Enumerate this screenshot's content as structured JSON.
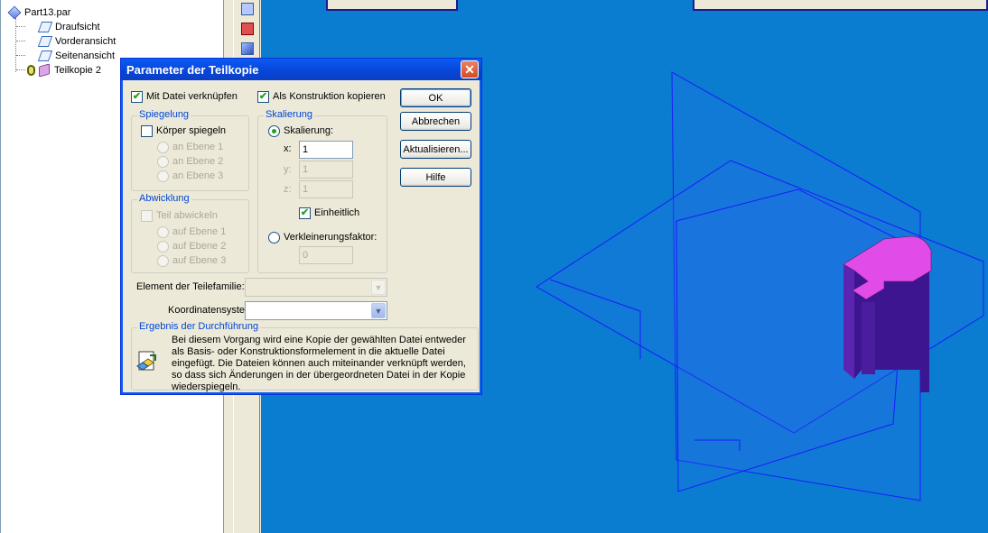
{
  "tree": {
    "root": "Part13.par",
    "items": [
      "Draufsicht",
      "Vorderansicht",
      "Seitenansicht",
      "Teilkopie 2"
    ]
  },
  "dialog": {
    "title": "Parameter der Teilkopie",
    "close_glyph": "✕",
    "link_file_label": "Mit Datei verknüpfen",
    "link_file_checked": true,
    "as_construction_label": "Als Konstruktion kopieren",
    "as_construction_checked": true,
    "mirror": {
      "title": "Spiegelung",
      "mirror_body_label": "Körper spiegeln",
      "planes": [
        "an Ebene 1",
        "an Ebene 2",
        "an Ebene 3"
      ]
    },
    "unfold": {
      "title": "Abwicklung",
      "unfold_part_label": "Teil abwickeln",
      "planes": [
        "auf Ebene 1",
        "auf Ebene 2",
        "auf Ebene 3"
      ]
    },
    "scaling": {
      "title": "Skalierung",
      "scaling_label": "Skalierung:",
      "x_label": "x:",
      "y_label": "y:",
      "z_label": "z:",
      "x_value": "1",
      "y_value": "1",
      "z_value": "1",
      "uniform_label": "Einheitlich",
      "uniform_checked": true,
      "reduction_label": "Verkleinerungsfaktor:",
      "reduction_value": "0"
    },
    "buttons": {
      "ok": "OK",
      "cancel": "Abbrechen",
      "update": "Aktualisieren...",
      "help": "Hilfe"
    },
    "family_member_label": "Element der Teilefamilie:",
    "family_member_value": "",
    "coord_system_label": "Koordinatensystem:",
    "coord_system_value": "",
    "result": {
      "title": "Ergebnis der Durchführung",
      "text": "Bei diesem Vorgang wird eine Kopie der gewählten Datei entweder als Basis- oder Konstruktionsformelement in die aktuelle Datei eingefügt. Die Dateien können auch miteinander verknüpft werden, so dass sich Änderungen in der übergeordneten Datei in der Kopie wiederspiegeln."
    }
  },
  "colors": {
    "viewport_bg": "#0a7dd1",
    "plane_stroke": "#1a1aff",
    "part_top": "#e14be8",
    "part_side": "#4b1a9c",
    "titlebar": "#0a46d9"
  }
}
